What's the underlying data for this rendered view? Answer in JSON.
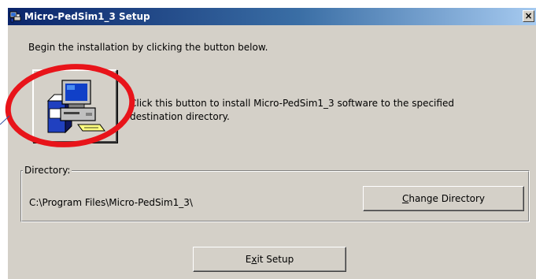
{
  "window": {
    "title": "Micro-PedSim1_3 Setup",
    "close_label": "×"
  },
  "main": {
    "instruction": "Begin the installation by clicking the button below.",
    "install_description": "Click this button to install Micro-PedSim1_3 software to the specified destination directory."
  },
  "directory": {
    "legend": "Directory:",
    "path": "C:\\Program Files\\Micro-PedSim1_3\\",
    "change_button": {
      "mnemonic": "C",
      "rest": "hange Directory"
    }
  },
  "exit_button": {
    "pre": "E",
    "mnemonic": "x",
    "rest": "it Setup"
  },
  "annotation": {
    "color": "#e8141a"
  },
  "colors": {
    "dialog_bg": "#d4d0c8",
    "titlebar_start": "#0a246a",
    "titlebar_end": "#a6caf0"
  }
}
